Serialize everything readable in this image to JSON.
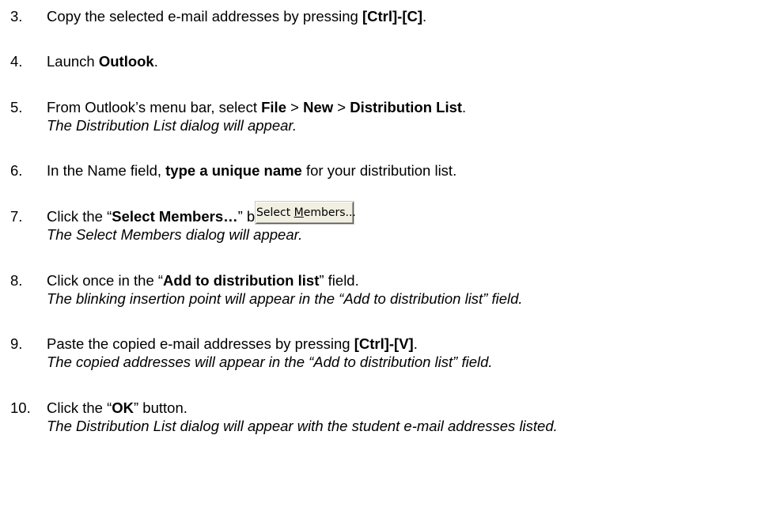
{
  "steps": [
    {
      "number": "3.",
      "pre": "Copy the selected e-mail addresses by pressing ",
      "bold": "[Ctrl]-[C]",
      "post": "."
    },
    {
      "number": "4.",
      "pre": "Launch ",
      "bold": "Outlook",
      "post": "."
    },
    {
      "number": "5.",
      "pre": "From Outlook’s menu bar, select ",
      "bold1": "File",
      "sep1": " > ",
      "bold2": "New",
      "sep2": " > ",
      "bold3": "Distribution List",
      "post": ".",
      "note": "The Distribution List dialog will appear."
    },
    {
      "number": "6.",
      "pre": "In the Name field, ",
      "bold": "type a unique name",
      "post": " for your distribution list."
    },
    {
      "number": "7.",
      "pre": "Click the “",
      "bold": "Select Members…",
      "post": "” button.",
      "note": "The Select Members dialog will appear.",
      "button": {
        "label_pre": "Select ",
        "label_accel": "M",
        "label_post": "embers..."
      }
    },
    {
      "number": "8.",
      "pre": "Click once in the “",
      "bold": "Add to distribution list",
      "post": "” field.",
      "note": "The blinking insertion point will appear in the “Add to distribution list” field."
    },
    {
      "number": "9.",
      "pre": "Paste the copied e-mail addresses by pressing ",
      "bold": "[Ctrl]-[V]",
      "post": ".",
      "note": "The copied addresses will appear in the “Add to distribution list” field."
    },
    {
      "number": "10.",
      "pre": "Click the “",
      "bold": "OK",
      "post": "” button.",
      "note": "The Distribution List dialog will appear with the student e-mail addresses listed."
    }
  ]
}
